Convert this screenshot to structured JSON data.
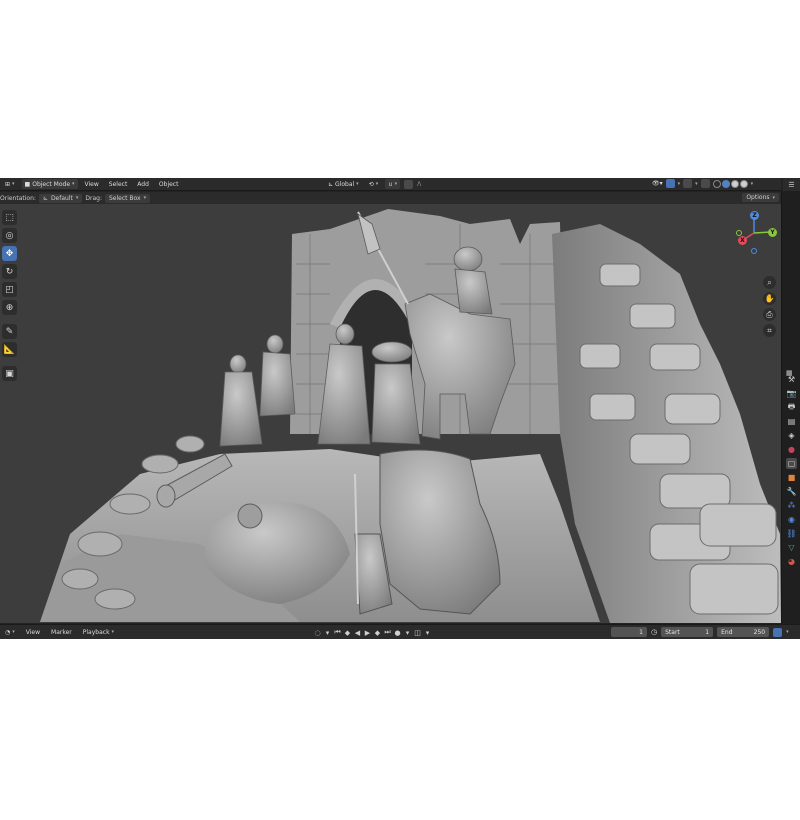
{
  "header": {
    "editor_type_icon": "3d-viewport-icon",
    "mode_label": "Object Mode",
    "menus": [
      "View",
      "Select",
      "Add",
      "Object"
    ],
    "orientation_value": "Global",
    "transform_pivot_icon": "pivot-icon",
    "snap_icon": "magnet-icon",
    "proportional_icon": "proportional-edit-icon"
  },
  "tool_settings": {
    "orientation_label": "Orientation:",
    "orientation_value": "Default",
    "drag_label": "Drag:",
    "drag_value": "Select Box",
    "options_label": "Options"
  },
  "toolbox": {
    "tools": [
      "select-box-icon",
      "cursor-icon",
      "move-icon",
      "rotate-icon",
      "scale-icon",
      "transform-icon",
      "annotate-icon",
      "measure-icon",
      "add-cube-icon"
    ],
    "active_tool": "move-icon"
  },
  "gizmo": {
    "axes": [
      "Z",
      "Y",
      "X"
    ]
  },
  "nav_buttons": [
    "zoom-icon",
    "pan-hand-icon",
    "camera-icon",
    "perspective-grid-icon"
  ],
  "properties_tabs": [
    "tool-icon",
    "render-icon",
    "output-icon",
    "view-layer-icon",
    "scene-icon",
    "world-icon",
    "object-icon",
    "modifier-icon",
    "particles-icon",
    "physics-icon",
    "constraints-icon",
    "data-icon",
    "material-icon"
  ],
  "timeline": {
    "editor_icon": "timeline-clock-icon",
    "menus": [
      "View",
      "Marker",
      "Playback"
    ],
    "current_frame": "1",
    "start_label": "Start",
    "start_value": "1",
    "end_label": "End",
    "end_value": "250"
  },
  "colors": {
    "accent": "#4772b3",
    "axis_x": "#e34a5a",
    "axis_y": "#8bc63f",
    "axis_z": "#4f8ae3",
    "viewport_bg": "#3d3d3d",
    "header_bg": "#2b2b2b"
  }
}
